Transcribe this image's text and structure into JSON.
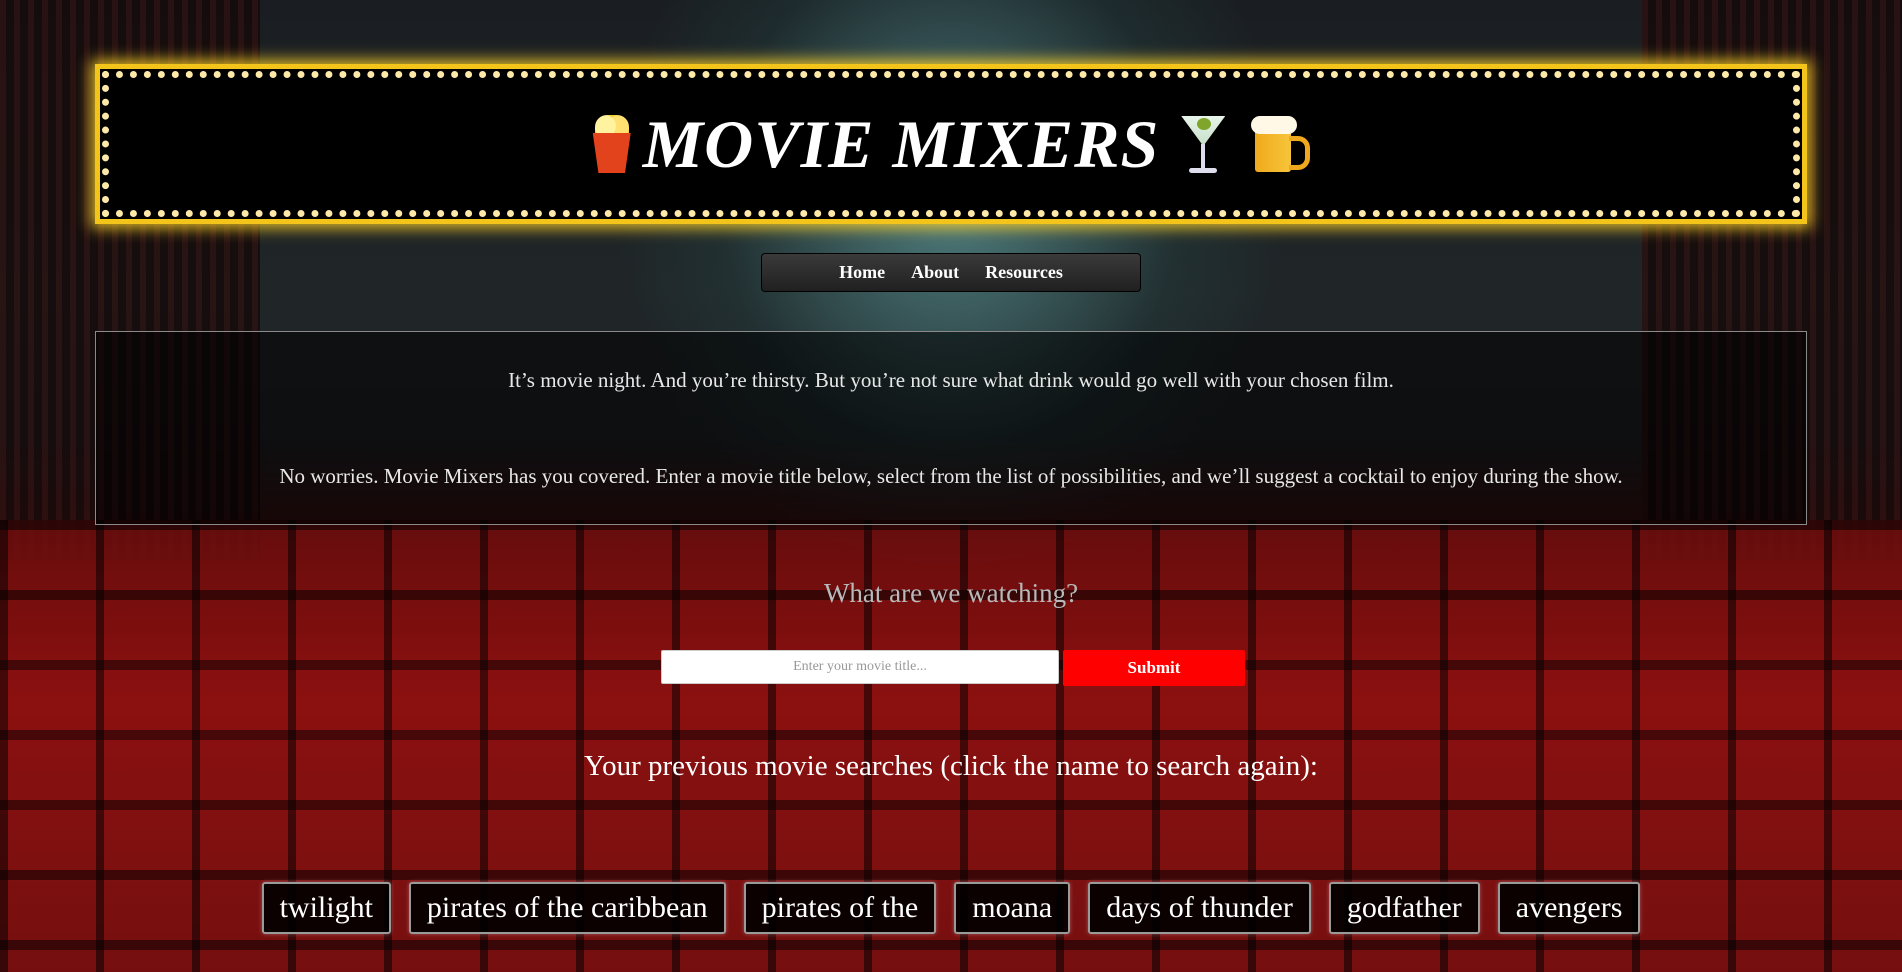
{
  "header": {
    "title": "MOVIE MIXERS",
    "icons": [
      "popcorn-icon",
      "cocktail-icon",
      "beer-mug-icon"
    ],
    "marquee_color": "#f3c51a"
  },
  "nav": {
    "items": [
      {
        "label": "Home"
      },
      {
        "label": "About"
      },
      {
        "label": "Resources"
      }
    ]
  },
  "intro": {
    "paragraph1": "It’s movie night. And you’re thirsty. But you’re not sure what drink would go well with your chosen film.",
    "paragraph2": "No worries. Movie Mixers has you covered. Enter a movie title below, select from the list of possibilities, and we’ll suggest a cocktail to enjoy during the show."
  },
  "search": {
    "prompt": "What are we watching?",
    "placeholder": "Enter your movie title...",
    "value": "",
    "submit_label": "Submit",
    "submit_color": "#ff0000"
  },
  "history": {
    "title": "Your previous movie searches (click the name to search again):",
    "items": [
      {
        "label": "twilight"
      },
      {
        "label": "pirates of the caribbean"
      },
      {
        "label": "pirates of the"
      },
      {
        "label": "moana"
      },
      {
        "label": "days of thunder"
      },
      {
        "label": "godfather"
      },
      {
        "label": "avengers"
      }
    ]
  }
}
